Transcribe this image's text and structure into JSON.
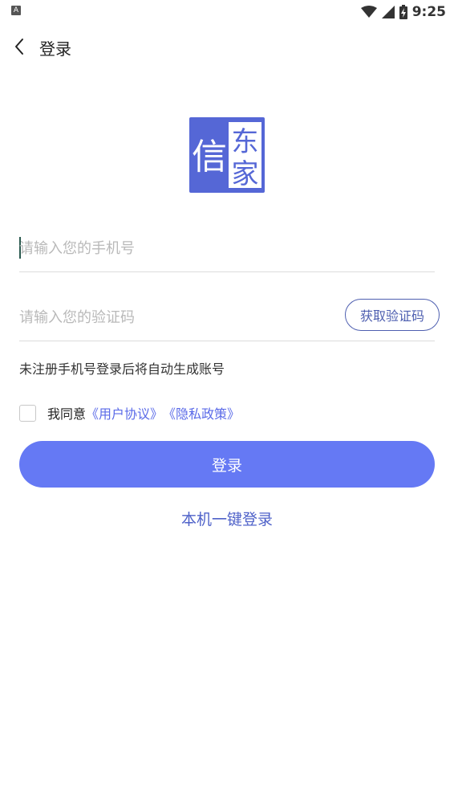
{
  "status_bar": {
    "left_icon_label": "A",
    "time": "9:25",
    "icons": [
      "wifi-icon",
      "cellular-signal-icon",
      "battery-charging-icon"
    ]
  },
  "header": {
    "back_icon": "chevron-left-icon",
    "title": "登录"
  },
  "logo": {
    "chars": [
      "信",
      "东",
      "家"
    ],
    "color": "#5567d6"
  },
  "form": {
    "phone_placeholder": "请输入您的手机号",
    "code_placeholder": "请输入您的验证码",
    "get_code_label": "获取验证码",
    "hint": "未注册手机号登录后将自动生成账号"
  },
  "agreement": {
    "prefix": "我同意",
    "user_agreement": "《用户协议》",
    "privacy_policy": "《隐私政策》",
    "checked": false
  },
  "actions": {
    "login_label": "登录",
    "one_key_login_label": "本机一键登录"
  },
  "colors": {
    "primary": "#6579f4",
    "link": "#5a6ae8",
    "button_outline": "#4e5fb0"
  }
}
